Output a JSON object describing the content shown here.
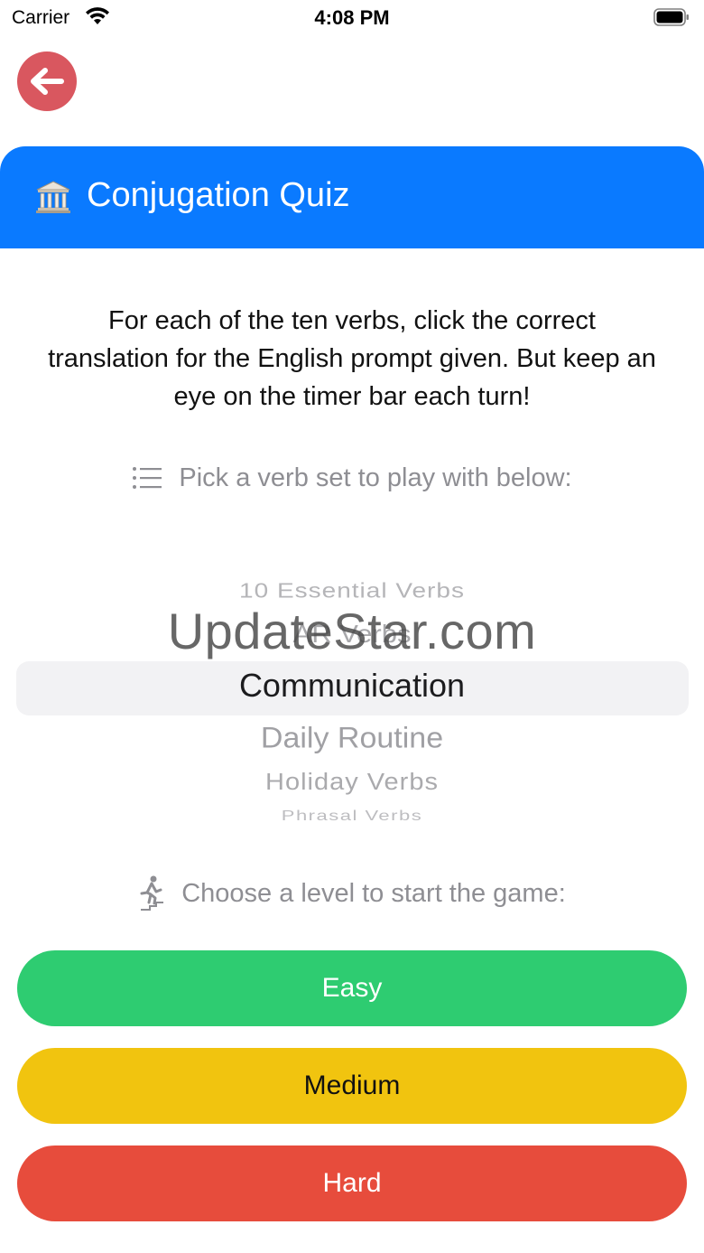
{
  "status_bar": {
    "carrier": "Carrier",
    "time": "4:08 PM",
    "icons": [
      "wifi-icon",
      "battery-icon"
    ]
  },
  "nav": {
    "back_icon": "arrow-left-icon",
    "back_color": "#d9575f"
  },
  "header": {
    "icon": "classical-building-icon",
    "title": "Conjugation Quiz",
    "color": "#0a7aff"
  },
  "intro": {
    "text": "For each of the ten verbs, click the correct translation for the English prompt given. But keep an eye on the timer bar each turn!"
  },
  "verb_set": {
    "hint_icon": "list-icon",
    "hint": "Pick a verb set to play with below:",
    "options": [
      "10 Essential Verbs",
      "AR Verbs",
      "Communication",
      "Daily Routine",
      "Holiday Verbs",
      "Phrasal Verbs",
      ""
    ],
    "selected": "Communication"
  },
  "watermark": "UpdateStar.com",
  "level": {
    "hint_icon": "figure-stairs-icon",
    "hint": "Choose a level to start the game:",
    "buttons": [
      {
        "label": "Easy",
        "color": "#2ecc71"
      },
      {
        "label": "Medium",
        "color": "#f1c40f"
      },
      {
        "label": "Hard",
        "color": "#e74c3c"
      }
    ]
  }
}
